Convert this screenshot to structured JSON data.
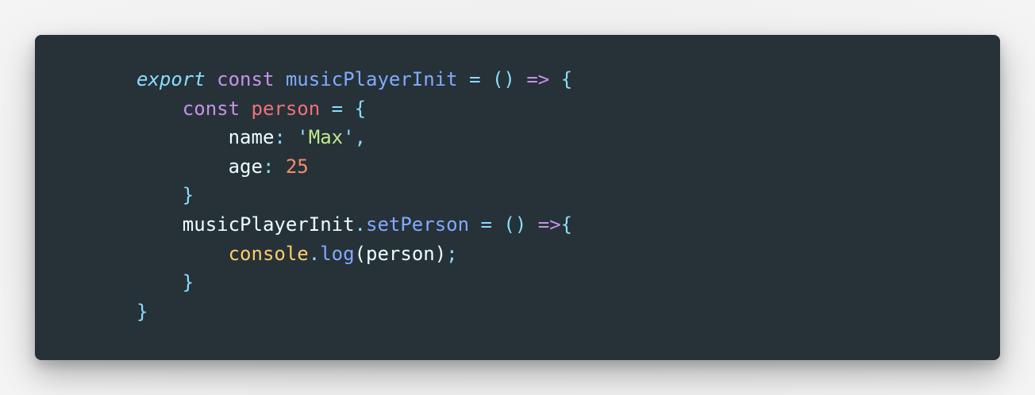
{
  "code": {
    "line1": {
      "export": "export",
      "const": "const",
      "name": "musicPlayerInit",
      "eq": "=",
      "parens": "()",
      "arrow": "=>",
      "brace": "{"
    },
    "line2": {
      "indent": "    ",
      "const": "const",
      "name": "person",
      "eq": "=",
      "brace": "{"
    },
    "line3": {
      "indent": "        ",
      "key": "name",
      "colon": ":",
      "quote_open": "'",
      "value": "Max",
      "quote_close": "'",
      "comma": ","
    },
    "line4": {
      "indent": "        ",
      "key": "age",
      "colon": ":",
      "value": "25"
    },
    "line5": {
      "indent": "    ",
      "brace": "}"
    },
    "line6": {
      "indent": "    ",
      "object": "musicPlayerInit",
      "dot": ".",
      "method": "setPerson",
      "eq": "=",
      "parens": "()",
      "arrow": "=>",
      "brace": "{"
    },
    "line7": {
      "indent": "        ",
      "object": "console",
      "dot": ".",
      "method": "log",
      "open": "(",
      "arg": "person",
      "close": ")",
      "semi": ";"
    },
    "line8": {
      "indent": "    ",
      "brace": "}"
    },
    "line9": {
      "brace": "}"
    }
  },
  "colors": {
    "background": "#263238",
    "keyword": "#c792ea",
    "function": "#82aaff",
    "operator": "#89ddff",
    "variable": "#f07178",
    "string": "#c3e88d",
    "number": "#f78c6c",
    "object": "#ffcb6b",
    "text": "#eeffff"
  }
}
